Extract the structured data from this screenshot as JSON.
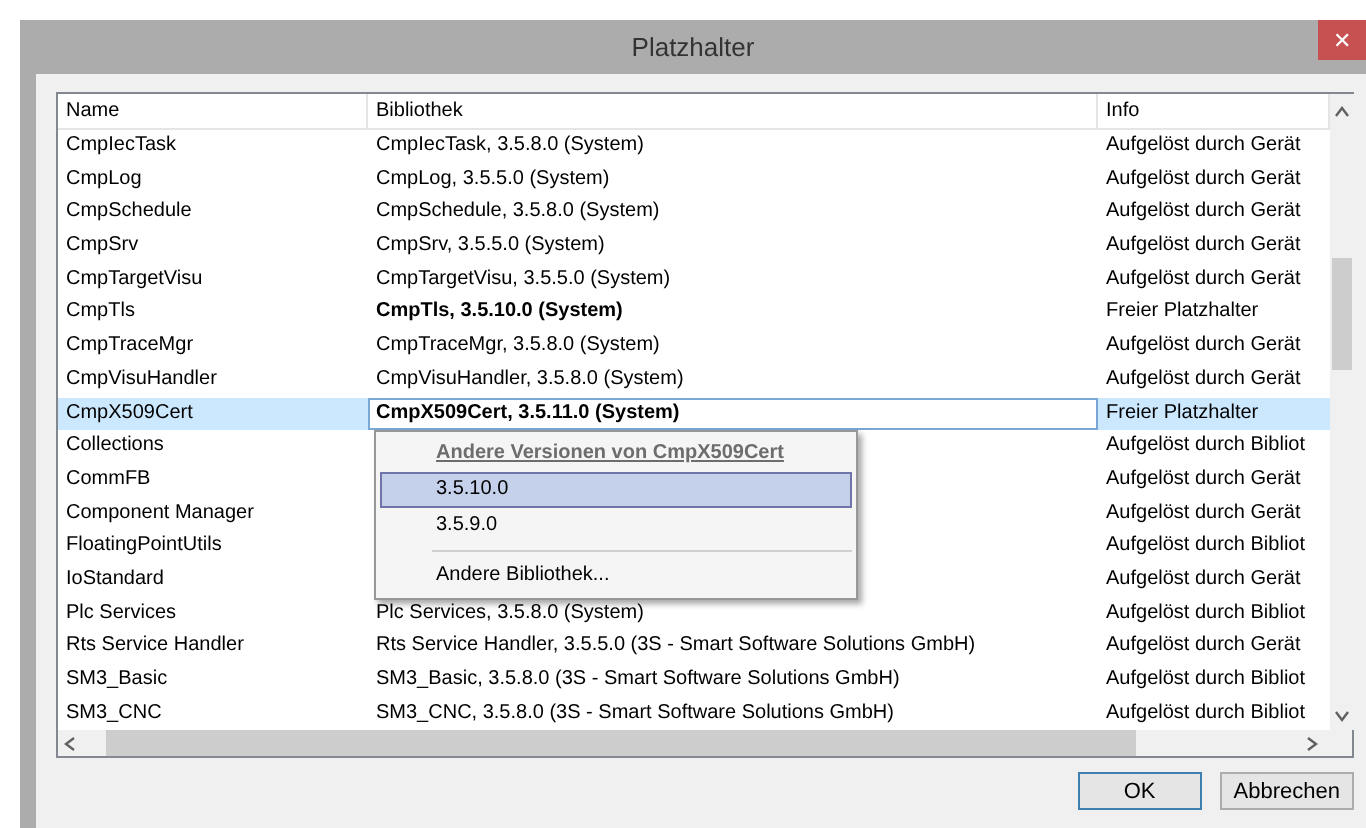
{
  "window": {
    "title": "Platzhalter",
    "close": "✕"
  },
  "table": {
    "columns": [
      "Name",
      "Bibliothek",
      "Info"
    ],
    "rows": [
      {
        "name": "CmpIecTask",
        "library": "CmpIecTask, 3.5.8.0 (System)",
        "info": "Aufgelöst durch Gerät",
        "bold": false,
        "selected": false
      },
      {
        "name": "CmpLog",
        "library": "CmpLog, 3.5.5.0 (System)",
        "info": "Aufgelöst durch Gerät",
        "bold": false,
        "selected": false
      },
      {
        "name": "CmpSchedule",
        "library": "CmpSchedule, 3.5.8.0 (System)",
        "info": "Aufgelöst durch Gerät",
        "bold": false,
        "selected": false
      },
      {
        "name": "CmpSrv",
        "library": "CmpSrv, 3.5.5.0 (System)",
        "info": "Aufgelöst durch Gerät",
        "bold": false,
        "selected": false
      },
      {
        "name": "CmpTargetVisu",
        "library": "CmpTargetVisu, 3.5.5.0 (System)",
        "info": "Aufgelöst durch Gerät",
        "bold": false,
        "selected": false
      },
      {
        "name": "CmpTls",
        "library": "CmpTls, 3.5.10.0 (System)",
        "info": "Freier Platzhalter",
        "bold": true,
        "selected": false
      },
      {
        "name": "CmpTraceMgr",
        "library": "CmpTraceMgr, 3.5.8.0 (System)",
        "info": "Aufgelöst durch Gerät",
        "bold": false,
        "selected": false
      },
      {
        "name": "CmpVisuHandler",
        "library": "CmpVisuHandler, 3.5.8.0 (System)",
        "info": "Aufgelöst durch Gerät",
        "bold": false,
        "selected": false
      },
      {
        "name": "CmpX509Cert",
        "library": "CmpX509Cert, 3.5.11.0 (System)",
        "info": "Freier Platzhalter",
        "bold": true,
        "selected": true
      },
      {
        "name": "Collections",
        "info": "Aufgelöst durch Bibliot",
        "selected": false
      },
      {
        "name": "CommFB",
        "info": "Aufgelöst durch Gerät",
        "selected": false
      },
      {
        "name": "Component Manager",
        "info": "Aufgelöst durch Gerät",
        "selected": false
      },
      {
        "name": "FloatingPointUtils",
        "info": "Aufgelöst durch Bibliot",
        "selected": false
      },
      {
        "name": "IoStandard",
        "info": "Aufgelöst durch Gerät",
        "selected": false
      },
      {
        "name": "Plc Services",
        "library": "Plc Services, 3.5.8.0 (System)",
        "info": "Aufgelöst durch Bibliot",
        "bold": false,
        "selected": false
      },
      {
        "name": "Rts Service Handler",
        "library": "Rts Service Handler, 3.5.5.0 (3S - Smart Software Solutions GmbH)",
        "info": "Aufgelöst durch Gerät",
        "bold": false,
        "selected": false
      },
      {
        "name": "SM3_Basic",
        "library": "SM3_Basic, 3.5.8.0 (3S - Smart Software Solutions GmbH)",
        "info": "Aufgelöst durch Bibliot",
        "bold": false,
        "selected": false
      },
      {
        "name": "SM3_CNC",
        "library": "SM3_CNC, 3.5.8.0 (3S - Smart Software Solutions GmbH)",
        "info": "Aufgelöst durch Bibliot",
        "bold": false,
        "selected": false
      }
    ]
  },
  "menu": {
    "heading": "Andere Versionen von CmpX509Cert",
    "items": [
      {
        "label": "3.5.10.0",
        "selected": true
      },
      {
        "label": "3.5.9.0",
        "selected": false
      }
    ],
    "other": "Andere Bibliothek..."
  },
  "buttons": [
    {
      "label": "OK",
      "default": true
    },
    {
      "label": "Abbrechen",
      "default": false
    }
  ]
}
